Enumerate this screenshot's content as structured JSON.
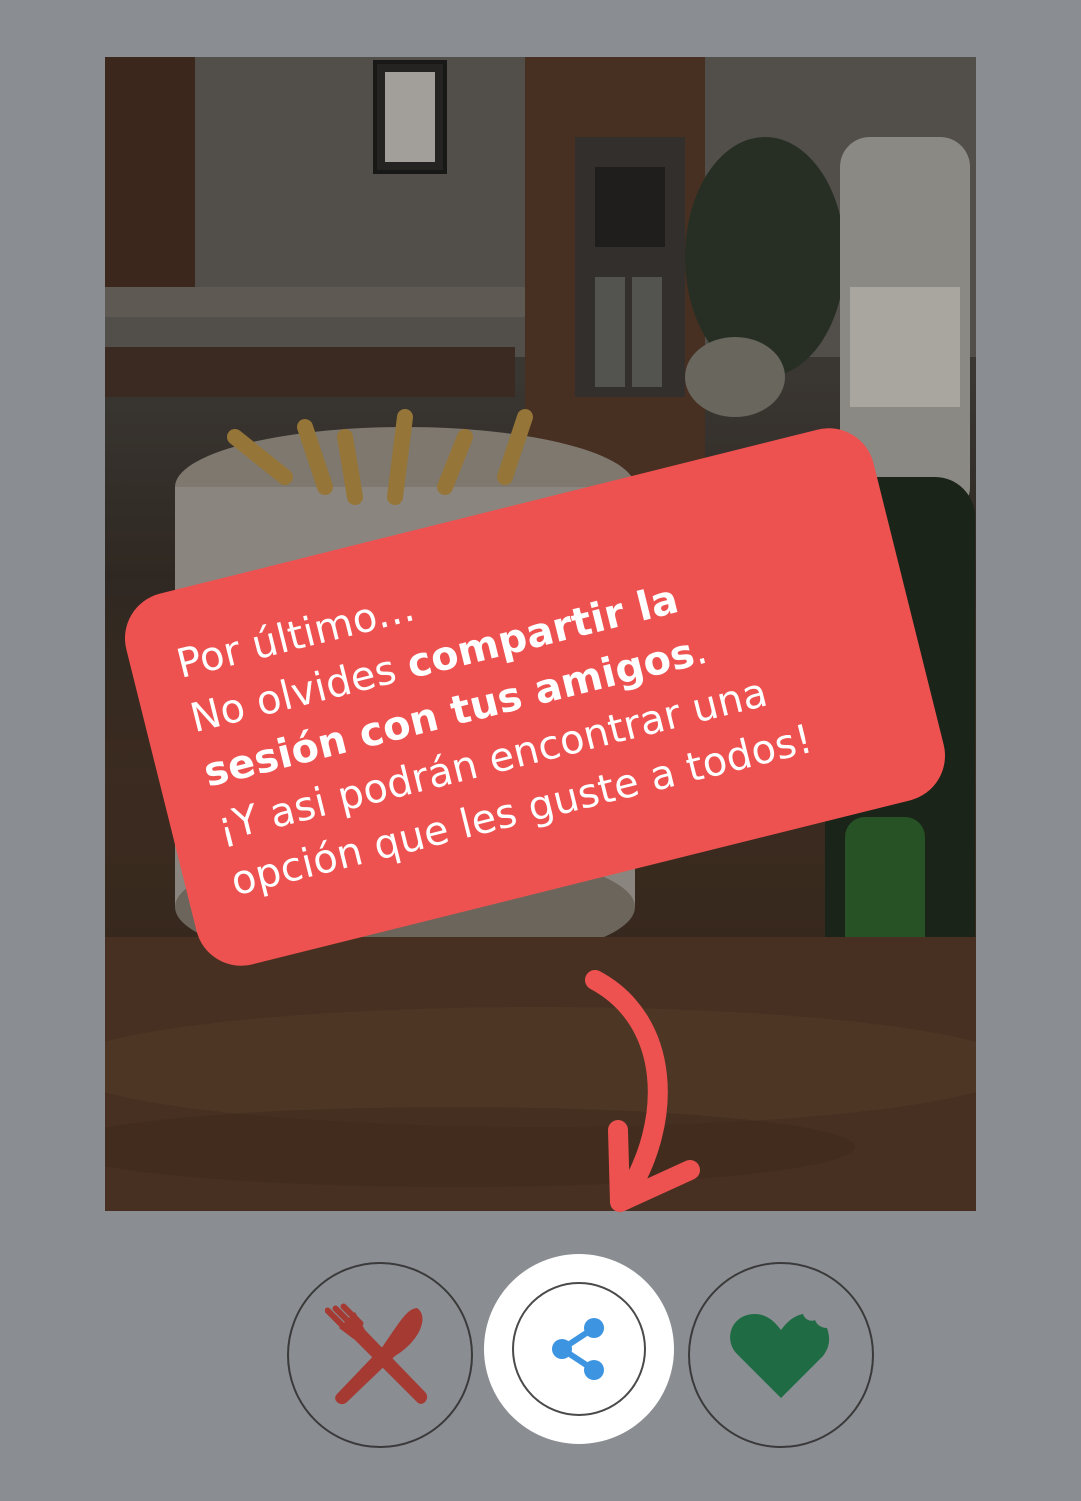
{
  "tooltip": {
    "line1": "Por último...",
    "line2_prefix": "No olvides ",
    "line2_bold": "compartir la",
    "line3_bold": "sesión con tus amigos",
    "line3_suffix": ".",
    "line4": "¡Y asi podrán encontrar una",
    "line5": "opción que les guste a todos!"
  },
  "colors": {
    "background": "#8a8d92",
    "tooltip": "#ee5250",
    "dislike": "#a53a33",
    "share": "#3d94e0",
    "like": "#1f6b43"
  },
  "icons": {
    "dislike": "crossed-fork-knife-icon",
    "share": "share-icon",
    "like": "bitten-heart-icon",
    "arrow": "curved-arrow-down-icon"
  }
}
